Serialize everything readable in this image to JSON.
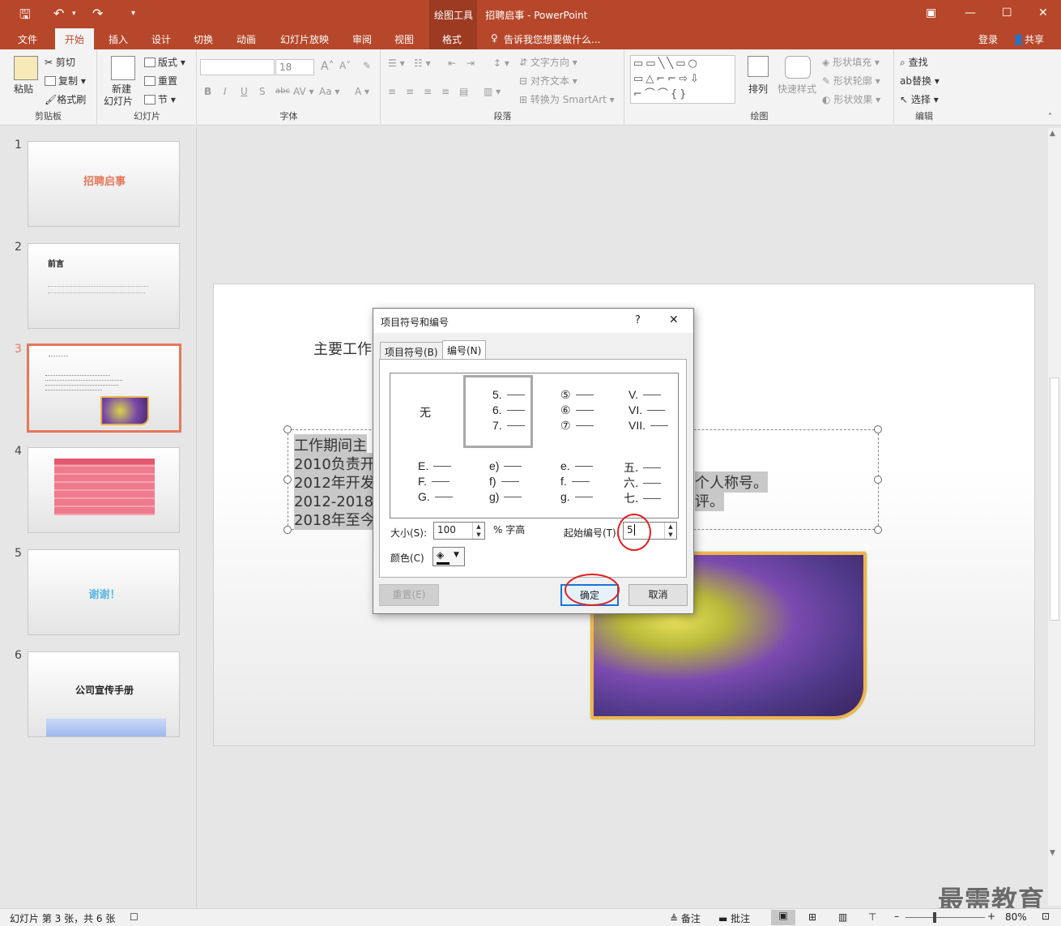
{
  "titlebar": {
    "contextual_tab": "绘图工具",
    "doc_title": "招聘启事 - PowerPoint"
  },
  "tabs": {
    "file": "文件",
    "home": "开始",
    "insert": "插入",
    "design": "设计",
    "transitions": "切换",
    "animations": "动画",
    "slideshow": "幻灯片放映",
    "review": "审阅",
    "view": "视图",
    "format": "格式",
    "tell_me": "告诉我您想要做什么...",
    "login": "登录",
    "share": "共享"
  },
  "ribbon": {
    "clipboard": {
      "paste": "粘贴",
      "cut": "剪切",
      "copy": "复制",
      "format_painter": "格式刷",
      "label": "剪贴板"
    },
    "slides": {
      "new_slide": "新建",
      "new_slide2": "幻灯片",
      "layout": "版式",
      "reset": "重置",
      "section": "节",
      "label": "幻灯片"
    },
    "font": {
      "size": "18",
      "label": "字体"
    },
    "paragraph": {
      "text_direction": "文字方向",
      "align_text": "对齐文本",
      "smartart": "转换为 SmartArt",
      "label": "段落"
    },
    "drawing": {
      "arrange": "排列",
      "quick_styles": "快速样式",
      "shape_fill": "形状填充",
      "shape_outline": "形状轮廓",
      "shape_effects": "形状效果",
      "label": "绘图"
    },
    "editing": {
      "find": "查找",
      "replace": "替换",
      "select": "选择",
      "label": "编辑"
    }
  },
  "slides_pane": [
    {
      "num": "1",
      "title": "招聘启事"
    },
    {
      "num": "2",
      "title": "前言"
    },
    {
      "num": "3",
      "title": ""
    },
    {
      "num": "4",
      "title": ""
    },
    {
      "num": "5",
      "title": "谢谢！"
    },
    {
      "num": "6",
      "title": "公司宣传手册"
    }
  ],
  "slide": {
    "heading": "主要工作",
    "lines": [
      "工作期间主",
      "2010负责开",
      "2012年开发",
      "2012-2018年",
      "2018年至今"
    ],
    "right_line1": "个人称号。",
    "right_line2": "评。"
  },
  "dialog": {
    "title": "项目符号和编号",
    "help": "?",
    "close": "✕",
    "tab_bullets": "项目符号(B)",
    "tab_numbering": "编号(N)",
    "gallery": {
      "none": "无",
      "row1": [
        [
          "5.",
          "6.",
          "7."
        ],
        [
          "⑤",
          "⑥",
          "⑦"
        ],
        [
          "V.",
          "VI.",
          "VII."
        ]
      ],
      "row2": [
        [
          "E.",
          "F.",
          "G."
        ],
        [
          "e)",
          "f)",
          "g)"
        ],
        [
          "e.",
          "f.",
          "g."
        ],
        [
          "五.",
          "六.",
          "七."
        ]
      ]
    },
    "size_label": "大小(S):",
    "size_value": "100",
    "size_unit": "% 字高",
    "start_label": "起始编号(T):",
    "start_value": "5",
    "color_label": "颜色(C)",
    "reset": "重置(E)",
    "ok": "确定",
    "cancel": "取消"
  },
  "status": {
    "slide_info": "幻灯片 第 3 张，共 6 张",
    "notes": "备注",
    "comments": "批注",
    "zoom": "80%"
  },
  "watermark": "最需教育"
}
